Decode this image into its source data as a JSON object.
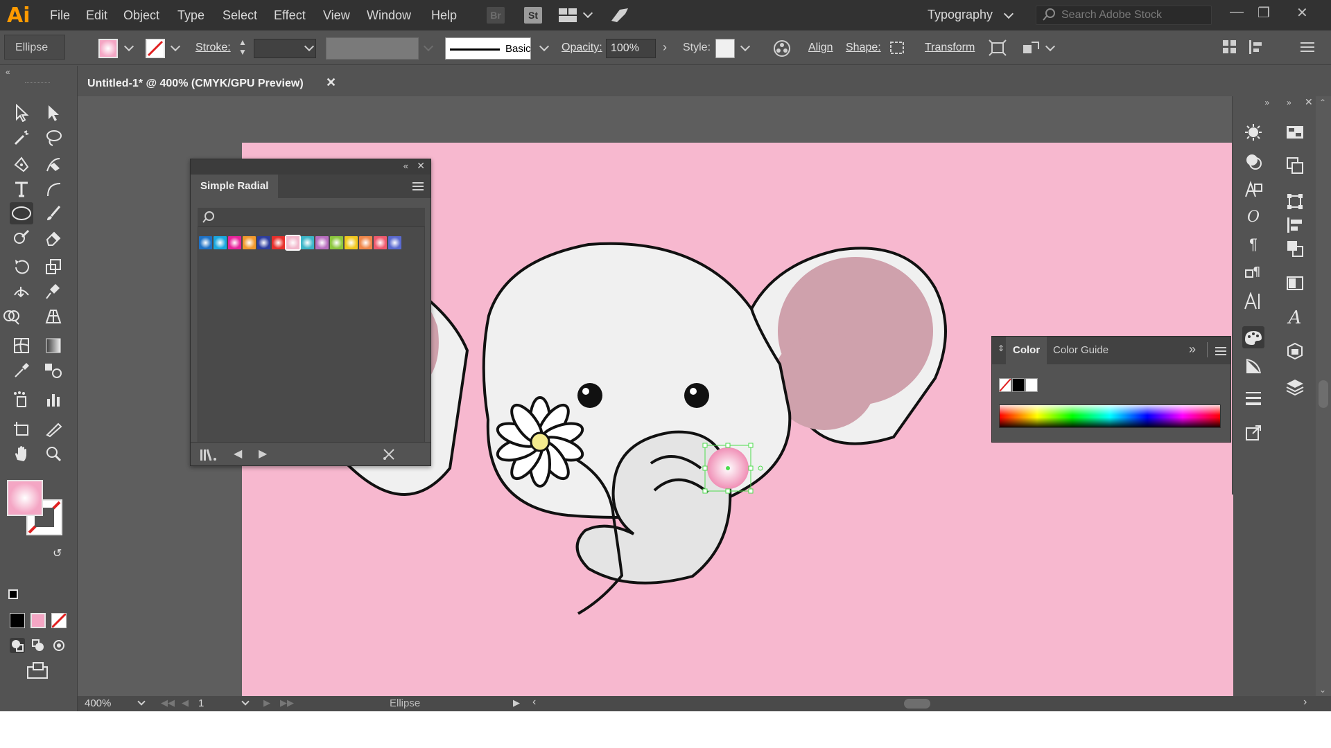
{
  "app": {
    "logo": "Ai"
  },
  "menu": [
    "File",
    "Edit",
    "Object",
    "Type",
    "Select",
    "Effect",
    "View",
    "Window",
    "Help"
  ],
  "menubar_icons": {
    "bridge": "Br",
    "stock": "St"
  },
  "workspace": "Typography",
  "search": {
    "placeholder": "Search Adobe Stock"
  },
  "control": {
    "object_type": "Ellipse",
    "stroke_label": "Stroke:",
    "brush_label": "Basic",
    "opacity_label": "Opacity:",
    "opacity_value": "100%",
    "style_label": "Style:",
    "align_label": "Align",
    "shape_label": "Shape:",
    "transform_label": "Transform"
  },
  "document": {
    "tab_title": "Untitled-1* @ 400% (CMYK/GPU Preview)"
  },
  "radial_panel": {
    "tab": "Simple Radial",
    "swatches": [
      "#1e72c6",
      "#1aa8e0",
      "#e8239c",
      "#f29a2e",
      "#2d3d9e",
      "#e8302c",
      "#f2b8cc",
      "#3cb6c8",
      "#b86ec0",
      "#8cc63e",
      "#f2c81e",
      "#f0874a",
      "#ef5a6e",
      "#5a6ad0"
    ]
  },
  "color_panel": {
    "tab_color": "Color",
    "tab_guide": "Color Guide"
  },
  "status": {
    "zoom": "400%",
    "page": "1",
    "tool": "Ellipse"
  },
  "colors": {
    "artboard": "#f7b8cf",
    "fill": "#f4a6c4",
    "selection": "#4ddd4d"
  }
}
